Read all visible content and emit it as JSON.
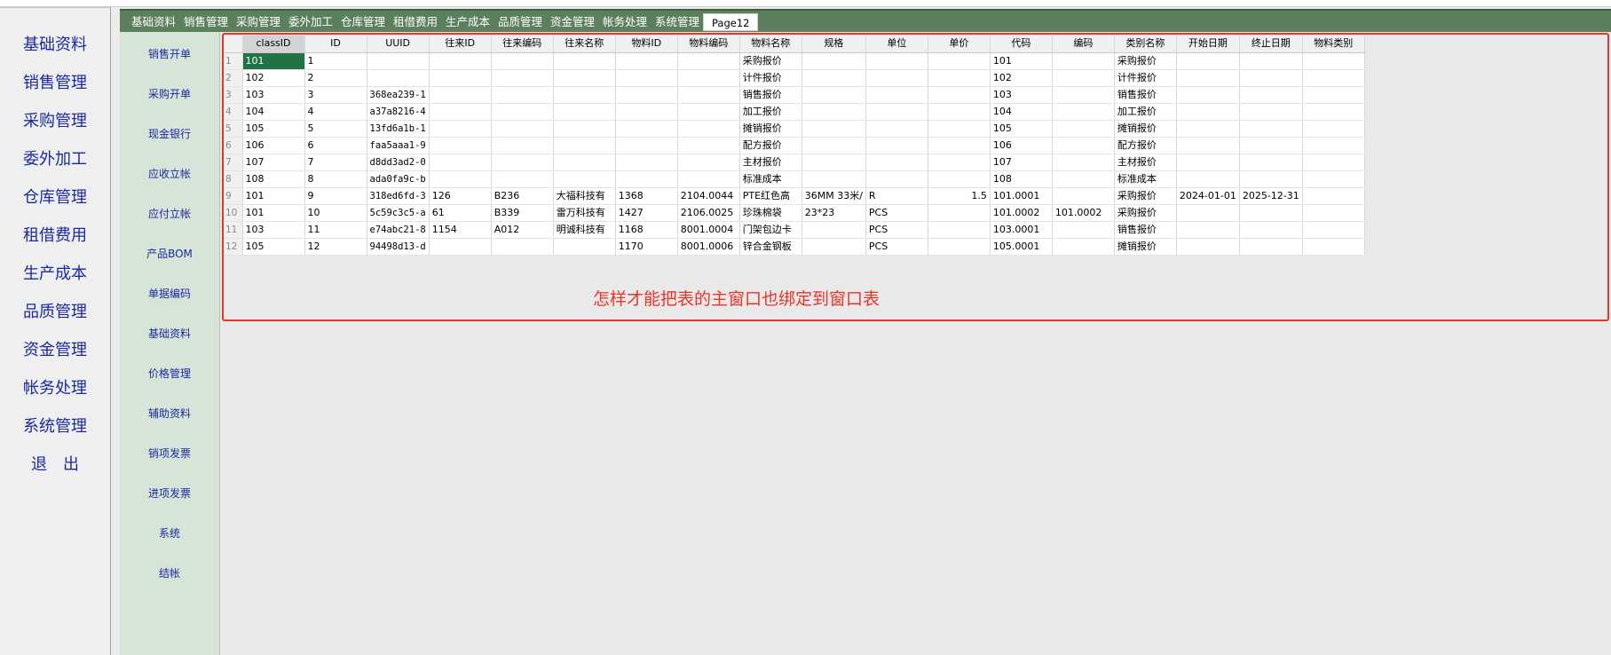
{
  "left_nav": [
    "基础资料",
    "销售管理",
    "采购管理",
    "委外加工",
    "仓库管理",
    "租借费用",
    "生产成本",
    "品质管理",
    "资金管理",
    "帐务处理",
    "系统管理",
    "退　出"
  ],
  "tabs": [
    "基础资料",
    "销售管理",
    "采购管理",
    "委外加工",
    "仓库管理",
    "租借费用",
    "生产成本",
    "品质管理",
    "资金管理",
    "帐务处理",
    "系统管理",
    "Page12"
  ],
  "active_tab": "Page12",
  "sub_nav": [
    "销售开单",
    "采购开单",
    "现金银行",
    "应收立帐",
    "应付立帐",
    "产品BOM",
    "单据编码",
    "基础资料",
    "价格管理",
    "辅助资料",
    "销项发票",
    "进项发票",
    "系统",
    "结帐"
  ],
  "grid": {
    "columns": [
      "classID",
      "ID",
      "UUID",
      "往来ID",
      "往来编码",
      "往来名称",
      "物料ID",
      "物料编码",
      "物料名称",
      "规格",
      "单位",
      "单价",
      "代码",
      "编码",
      "类别名称",
      "开始日期",
      "终止日期",
      "物料类别"
    ],
    "rows": [
      [
        "101",
        "1",
        "",
        "",
        "",
        "",
        "",
        "",
        "采购报价",
        "",
        "",
        "",
        "101",
        "",
        "采购报价",
        "",
        "",
        ""
      ],
      [
        "102",
        "2",
        "",
        "",
        "",
        "",
        "",
        "",
        "计件报价",
        "",
        "",
        "",
        "102",
        "",
        "计件报价",
        "",
        "",
        ""
      ],
      [
        "103",
        "3",
        "368ea239-1",
        "",
        "",
        "",
        "",
        "",
        "销售报价",
        "",
        "",
        "",
        "103",
        "",
        "销售报价",
        "",
        "",
        ""
      ],
      [
        "104",
        "4",
        "a37a8216-4",
        "",
        "",
        "",
        "",
        "",
        "加工报价",
        "",
        "",
        "",
        "104",
        "",
        "加工报价",
        "",
        "",
        ""
      ],
      [
        "105",
        "5",
        "13fd6a1b-1",
        "",
        "",
        "",
        "",
        "",
        "摊销报价",
        "",
        "",
        "",
        "105",
        "",
        "摊销报价",
        "",
        "",
        ""
      ],
      [
        "106",
        "6",
        "faa5aaa1-9",
        "",
        "",
        "",
        "",
        "",
        "配方报价",
        "",
        "",
        "",
        "106",
        "",
        "配方报价",
        "",
        "",
        ""
      ],
      [
        "107",
        "7",
        "d8dd3ad2-0",
        "",
        "",
        "",
        "",
        "",
        "主材报价",
        "",
        "",
        "",
        "107",
        "",
        "主材报价",
        "",
        "",
        ""
      ],
      [
        "108",
        "8",
        "ada0fa9c-b",
        "",
        "",
        "",
        "",
        "",
        "标准成本",
        "",
        "",
        "",
        "108",
        "",
        "标准成本",
        "",
        "",
        ""
      ],
      [
        "101",
        "9",
        "318ed6fd-3",
        "126",
        "B236",
        "大福科技有",
        "1368",
        "2104.0044",
        "PTE红色高",
        "36MM 33米/",
        "R",
        "1.5",
        "101.0001",
        "",
        "采购报价",
        "2024-01-01",
        "2025-12-31",
        ""
      ],
      [
        "101",
        "10",
        "5c59c3c5-a",
        "61",
        "B339",
        "雷万科技有",
        "1427",
        "2106.0025",
        "珍珠棉袋",
        "23*23",
        "PCS",
        "",
        "101.0002",
        "101.0002",
        "采购报价",
        "",
        "",
        ""
      ],
      [
        "103",
        "11",
        "e74abc21-8",
        "1154",
        "A012",
        "明诚科技有",
        "1168",
        "8001.0004",
        "门架包边卡",
        "",
        "PCS",
        "",
        "103.0001",
        "",
        "销售报价",
        "",
        "",
        ""
      ],
      [
        "105",
        "12",
        "94498d13-d",
        "",
        "",
        "",
        "1170",
        "8001.0006",
        "锌合金钢板",
        "",
        "PCS",
        "",
        "105.0001",
        "",
        "摊销报价",
        "",
        "",
        ""
      ]
    ]
  },
  "annotation_text": "怎样才能把表的主窗口也绑定到窗口表",
  "colors": {
    "tab_bar": "#5c7f5e",
    "sub_nav": "#d7e4d8",
    "nav_text": "#1a2aa0",
    "selected_cell": "#217346",
    "annotation": "#e8342b"
  }
}
